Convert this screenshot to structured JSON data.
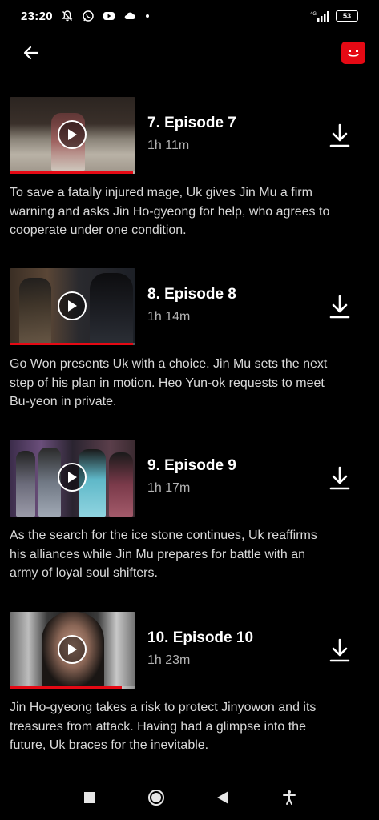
{
  "status_bar": {
    "time": "23:20",
    "battery": "53",
    "network": "4G",
    "icons": [
      "mute-bell-icon",
      "whatsapp-icon",
      "youtube-icon",
      "cloud-icon",
      "dot-icon"
    ]
  },
  "header": {
    "back_icon": "arrow-left-icon",
    "profile_icon": "smiley-profile-icon",
    "profile_color": "#e50914"
  },
  "episodes": [
    {
      "title": "7. Episode 7",
      "duration": "1h 11m",
      "description": "To save a fatally injured mage, Uk gives Jin Mu a firm warning and asks Jin Ho-gyeong for help, who agrees to cooperate under one condition.",
      "progress": 0.98
    },
    {
      "title": "8. Episode 8",
      "duration": "1h 14m",
      "description": "Go Won presents Uk with a choice. Jin Mu sets the next step of his plan in motion. Heo Yun-ok requests to meet Bu-yeon in private.",
      "progress": 0.98
    },
    {
      "title": "9. Episode 9",
      "duration": "1h 17m",
      "description": "As the search for the ice stone continues, Uk reaffirms his alliances while Jin Mu prepares for battle with an army of loyal soul shifters.",
      "progress": 0
    },
    {
      "title": "10. Episode 10",
      "duration": "1h 23m",
      "description": "Jin Ho-gyeong takes a risk to protect Jinyowon and its treasures from attack. Having had a glimpse into the future, Uk braces for the inevitable.",
      "progress": 0.89
    }
  ],
  "nav_bar": {
    "icons": [
      "recents-square-icon",
      "home-circle-icon",
      "back-triangle-icon",
      "accessibility-icon"
    ]
  },
  "colors": {
    "accent": "#e50914",
    "background": "#000000",
    "secondary_text": "#b3b3b3"
  }
}
